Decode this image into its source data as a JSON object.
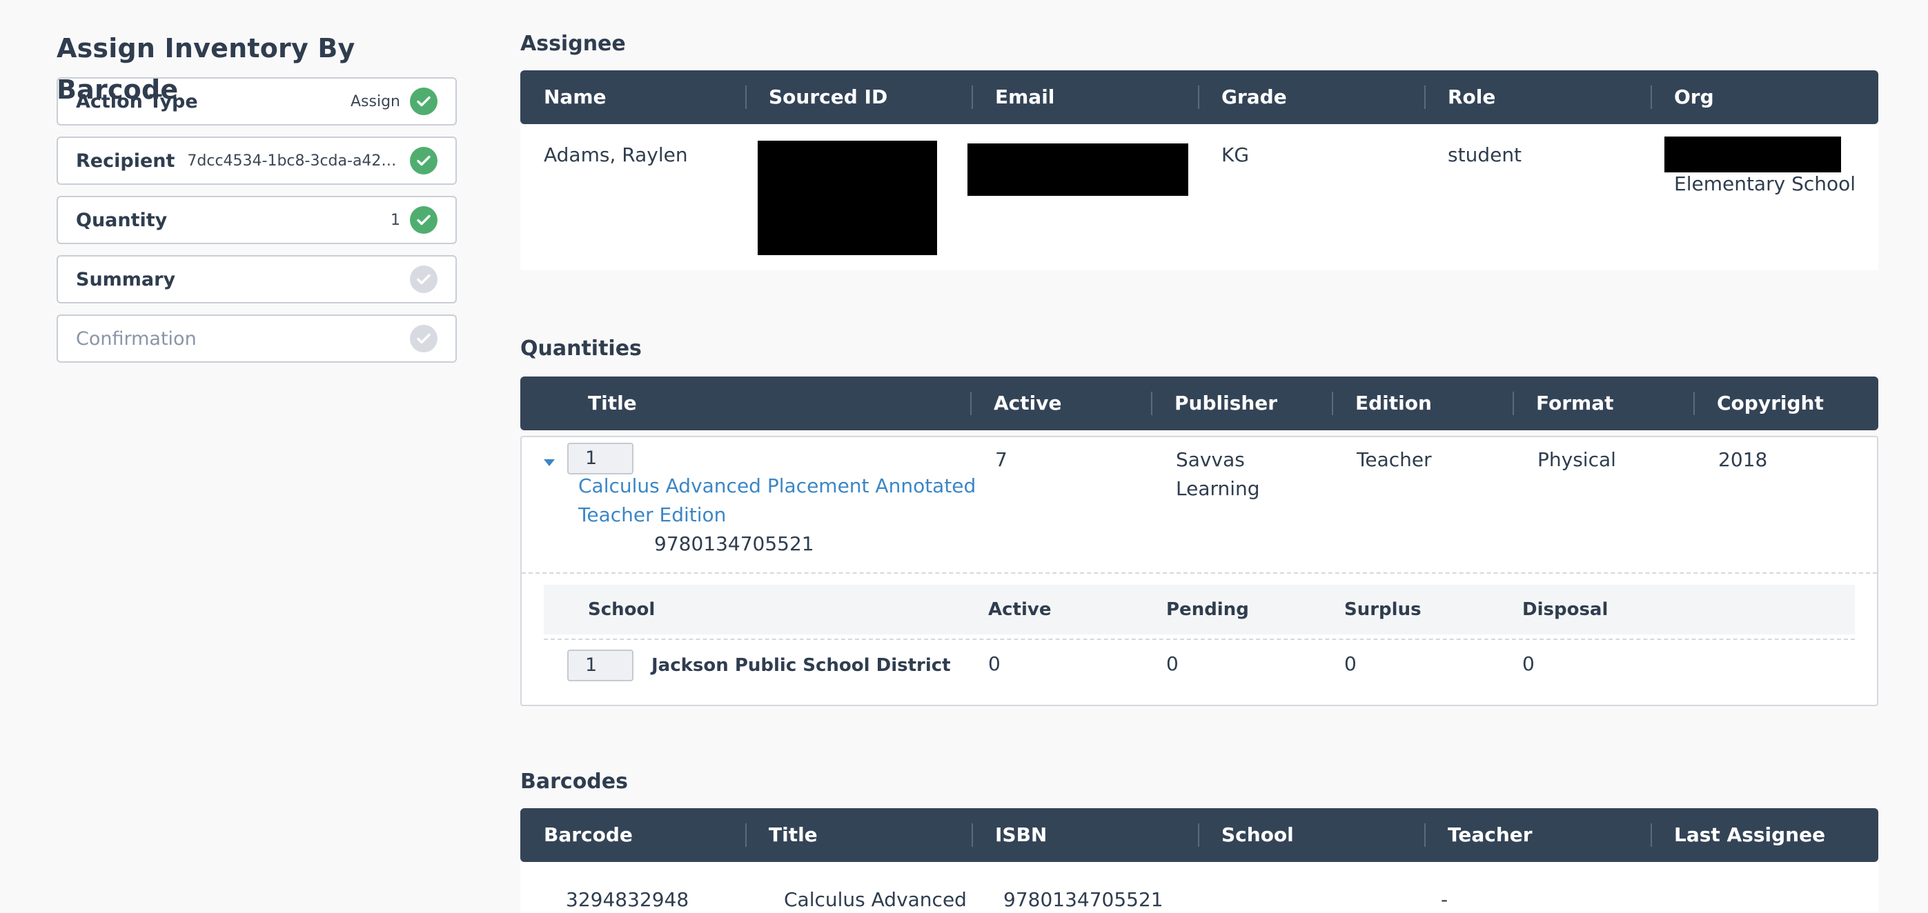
{
  "page_title": "Assign Inventory By Barcode",
  "steps": [
    {
      "label": "Action Type",
      "value": "Assign",
      "status": "complete"
    },
    {
      "label": "Recipient",
      "value": "7dcc4534-1bc8-3cda-a423-3...",
      "status": "complete"
    },
    {
      "label": "Quantity",
      "value": "1",
      "status": "complete"
    },
    {
      "label": "Summary",
      "value": "",
      "status": "pending"
    },
    {
      "label": "Confirmation",
      "value": "",
      "status": "pending"
    }
  ],
  "assignee": {
    "title": "Assignee",
    "columns": [
      "Name",
      "Sourced ID",
      "Email",
      "Grade",
      "Role",
      "Org"
    ],
    "row": {
      "name": "Adams, Raylen",
      "grade": "KG",
      "role": "student",
      "org": "Elementary School"
    }
  },
  "quantities": {
    "title": "Quantities",
    "columns": [
      "Title",
      "Active",
      "Publisher",
      "Edition",
      "Format",
      "Copyright"
    ],
    "item": {
      "qty": "1",
      "title_line1": "Calculus Advanced Placement Annotated",
      "title_line2": "Teacher Edition",
      "isbn": "9780134705521",
      "active": "7",
      "publisher_line1": "Savvas",
      "publisher_line2": "Learning",
      "edition": "Teacher",
      "format": "Physical",
      "copyright": "2018"
    },
    "school_columns": [
      "School",
      "Active",
      "Pending",
      "Surplus",
      "Disposal"
    ],
    "school_row": {
      "qty": "1",
      "school": "Jackson Public School District",
      "active": "0",
      "pending": "0",
      "surplus": "0",
      "disposal": "0"
    }
  },
  "barcodes": {
    "title": "Barcodes",
    "columns": [
      "Barcode",
      "Title",
      "ISBN",
      "School",
      "Teacher",
      "Last Assignee"
    ],
    "row": {
      "barcode": "3294832948",
      "title": "Calculus Advanced",
      "isbn": "9780134705521",
      "school": "",
      "teacher": "-",
      "last_assignee": ""
    }
  },
  "colors": {
    "header_bg": "#344457",
    "success": "#4fae6f",
    "link": "#3b86c6",
    "pending": "#d7dbe1"
  }
}
